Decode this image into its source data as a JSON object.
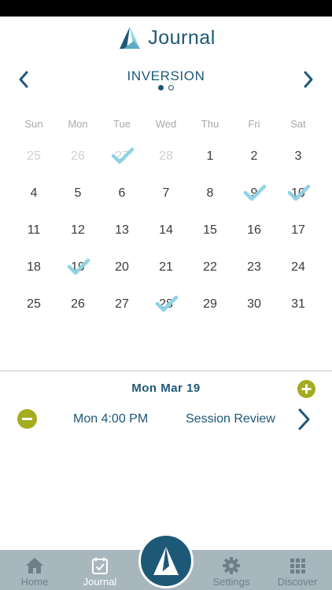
{
  "app": {
    "title": "Journal"
  },
  "nav": {
    "program_title": "INVERSION",
    "prev_icon": "chevron-left-icon",
    "next_icon": "chevron-right-icon",
    "pages": 2,
    "active_page": 1
  },
  "calendar": {
    "weekdays": [
      "Sun",
      "Mon",
      "Tue",
      "Wed",
      "Thu",
      "Fri",
      "Sat"
    ],
    "weeks": [
      [
        {
          "day": "25",
          "muted": true,
          "checked": false
        },
        {
          "day": "26",
          "muted": true,
          "checked": false
        },
        {
          "day": "27",
          "muted": true,
          "checked": true
        },
        {
          "day": "28",
          "muted": true,
          "checked": false
        },
        {
          "day": "1",
          "muted": false,
          "checked": false
        },
        {
          "day": "2",
          "muted": false,
          "checked": false
        },
        {
          "day": "3",
          "muted": false,
          "checked": false
        }
      ],
      [
        {
          "day": "4",
          "muted": false,
          "checked": false
        },
        {
          "day": "5",
          "muted": false,
          "checked": false
        },
        {
          "day": "6",
          "muted": false,
          "checked": false
        },
        {
          "day": "7",
          "muted": false,
          "checked": false
        },
        {
          "day": "8",
          "muted": false,
          "checked": false
        },
        {
          "day": "9",
          "muted": false,
          "checked": true
        },
        {
          "day": "10",
          "muted": false,
          "checked": true
        }
      ],
      [
        {
          "day": "11",
          "muted": false,
          "checked": false
        },
        {
          "day": "12",
          "muted": false,
          "checked": false
        },
        {
          "day": "13",
          "muted": false,
          "checked": false
        },
        {
          "day": "14",
          "muted": false,
          "checked": false
        },
        {
          "day": "15",
          "muted": false,
          "checked": false
        },
        {
          "day": "16",
          "muted": false,
          "checked": false
        },
        {
          "day": "17",
          "muted": false,
          "checked": false
        }
      ],
      [
        {
          "day": "18",
          "muted": false,
          "checked": false
        },
        {
          "day": "19",
          "muted": false,
          "checked": true
        },
        {
          "day": "20",
          "muted": false,
          "checked": false
        },
        {
          "day": "21",
          "muted": false,
          "checked": false
        },
        {
          "day": "22",
          "muted": false,
          "checked": false
        },
        {
          "day": "23",
          "muted": false,
          "checked": false
        },
        {
          "day": "24",
          "muted": false,
          "checked": false
        }
      ],
      [
        {
          "day": "25",
          "muted": false,
          "checked": false
        },
        {
          "day": "26",
          "muted": false,
          "checked": false
        },
        {
          "day": "27",
          "muted": false,
          "checked": false
        },
        {
          "day": "28",
          "muted": false,
          "checked": true
        },
        {
          "day": "29",
          "muted": false,
          "checked": false
        },
        {
          "day": "30",
          "muted": false,
          "checked": false
        },
        {
          "day": "31",
          "muted": false,
          "checked": false
        }
      ]
    ]
  },
  "selected": {
    "date_label": "Mon  Mar 19",
    "entries": [
      {
        "time": "Mon 4:00 PM",
        "title": "Session Review"
      }
    ]
  },
  "tabs": [
    {
      "label": "Home",
      "icon": "home-icon",
      "active": false
    },
    {
      "label": "Journal",
      "icon": "journal-icon",
      "active": true
    },
    {
      "label": "Settings",
      "icon": "gear-icon",
      "active": false
    },
    {
      "label": "Discover",
      "icon": "grid-icon",
      "active": false
    }
  ],
  "colors": {
    "primary": "#1e5877",
    "accent": "#a5ab1f",
    "check": "#8fd3e4",
    "tabbar": "#a8b6be"
  }
}
